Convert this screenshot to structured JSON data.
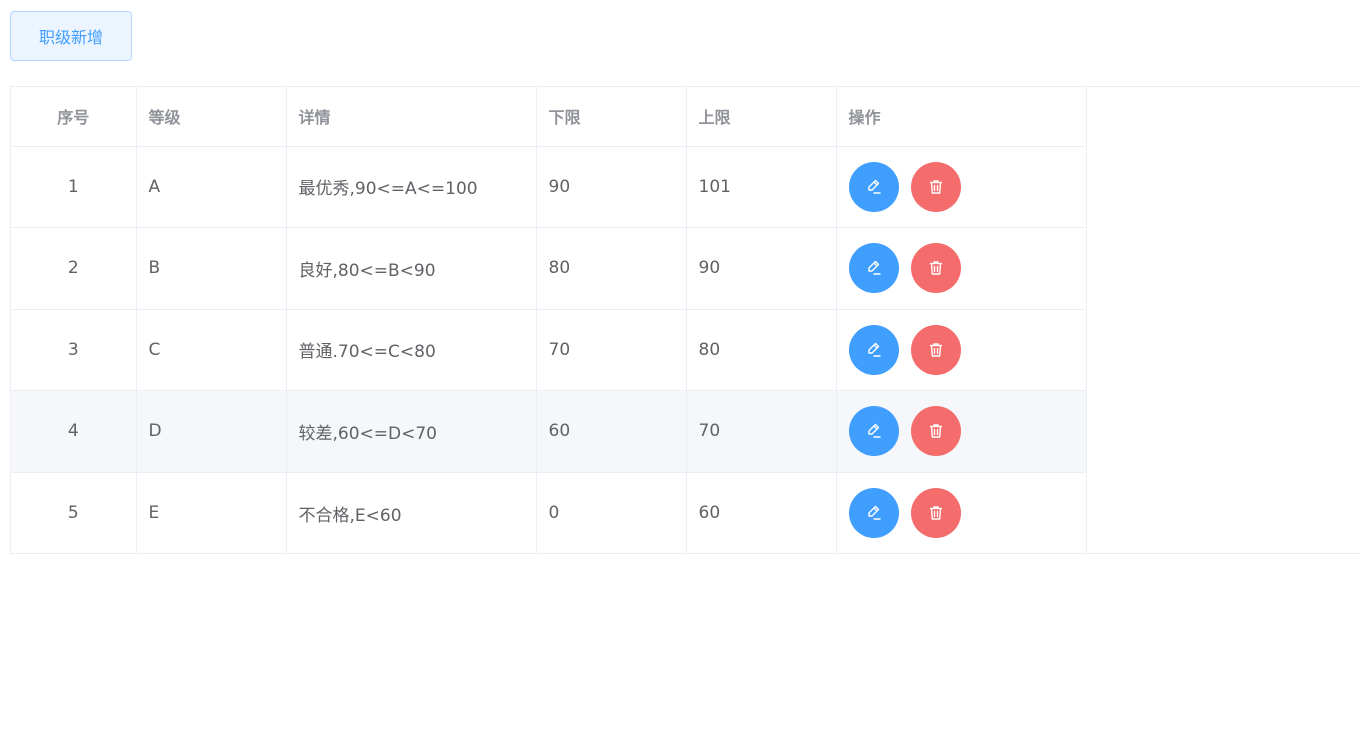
{
  "toolbar": {
    "add_label": "职级新增"
  },
  "table": {
    "headers": {
      "index": "序号",
      "grade": "等级",
      "detail": "详情",
      "lower": "下限",
      "upper": "上限",
      "actions": "操作"
    },
    "rows": [
      {
        "index": "1",
        "grade": "A",
        "detail": "最优秀,90<=A<=100",
        "lower": "90",
        "upper": "101"
      },
      {
        "index": "2",
        "grade": "B",
        "detail": "良好,80<=B<90",
        "lower": "80",
        "upper": "90"
      },
      {
        "index": "3",
        "grade": "C",
        "detail": "普通.70<=C<80",
        "lower": "70",
        "upper": "80"
      },
      {
        "index": "4",
        "grade": "D",
        "detail": "较差,60<=D<70",
        "lower": "60",
        "upper": "70"
      },
      {
        "index": "5",
        "grade": "E",
        "detail": "不合格,E<60",
        "lower": "0",
        "upper": "60"
      }
    ]
  },
  "icons": {
    "edit": "edit-icon",
    "delete": "delete-icon"
  },
  "colors": {
    "primary": "#409eff",
    "danger": "#f56c6c",
    "hover_row": "#f5f7fa"
  }
}
